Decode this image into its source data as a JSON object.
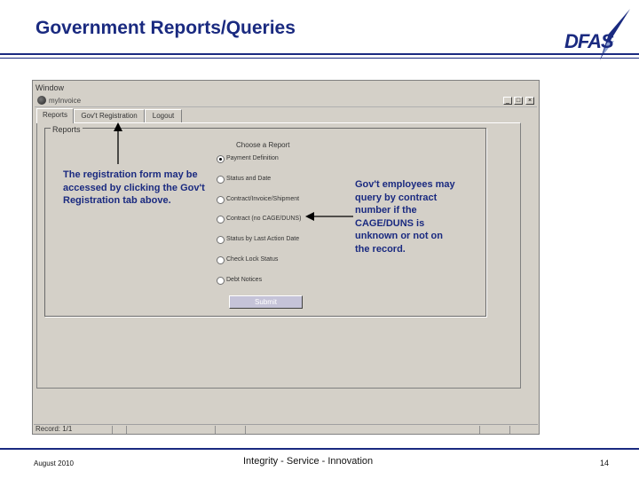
{
  "slide": {
    "title": "Government Reports/Queries",
    "logo_text": "DFAS"
  },
  "window": {
    "menu_label": "Window",
    "form_title": "myInvoice",
    "min_btn": "_",
    "max_btn": "□",
    "close_btn": "×",
    "tabs": [
      {
        "label": "Reports",
        "active": true
      },
      {
        "label": "Gov't Registration",
        "active": false
      },
      {
        "label": "Logout",
        "active": false
      }
    ],
    "reports_label": "Reports",
    "choose_label": "Choose a Report",
    "options": [
      {
        "label": "Payment Definition",
        "selected": true
      },
      {
        "label": "Status and Date",
        "selected": false
      },
      {
        "label": "Contract/Invoice/Shipment",
        "selected": false
      },
      {
        "label": "Contract (no CAGE/DUNS)",
        "selected": false
      },
      {
        "label": "Status by Last Action Date",
        "selected": false
      },
      {
        "label": "Check Lock Status",
        "selected": false
      },
      {
        "label": "Debt Notices",
        "selected": false
      }
    ],
    "submit_label": "Submit",
    "status_text": "Record: 1/1"
  },
  "annotations": {
    "left": "The registration form may be accessed by clicking the Gov't Registration tab above.",
    "right": "Gov't employees may query by contract number if the CAGE/DUNS is unknown or not on the record."
  },
  "footer": {
    "date": "August 2010",
    "tagline": "Integrity - Service - Innovation",
    "page_number": "14"
  },
  "colors": {
    "brand_navy": "#1a2a80",
    "window_gray": "#d4d0c8"
  }
}
